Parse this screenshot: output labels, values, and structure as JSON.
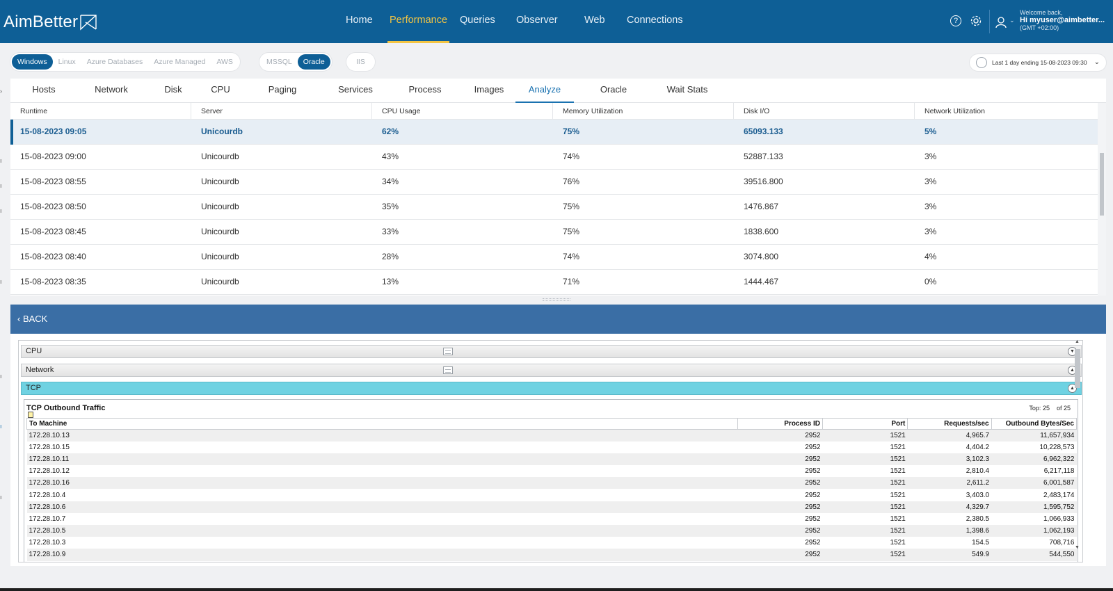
{
  "app": {
    "brand": "AimBetter",
    "nav": [
      "Home",
      "Performance",
      "Queries",
      "Observer",
      "Web",
      "Connections"
    ],
    "nav_active": "Performance",
    "user": {
      "welcome": "Welcome back,",
      "name": "Hi myuser@aimbetter...",
      "tz": "(GMT +02:00)"
    },
    "colors": {
      "header": "#0e5f96",
      "accent": "#f4c542",
      "selected_tab": "#1a72b0",
      "tcp_header": "#6fd2e2"
    }
  },
  "filters": {
    "os": [
      "Windows",
      "Linux",
      "Azure Databases",
      "Azure Managed",
      "AWS"
    ],
    "os_selected": "Windows",
    "db": [
      "MSSQL",
      "Oracle"
    ],
    "db_selected": "Oracle",
    "web": "IIS",
    "time_range": "Last 1 day ending  15-08-2023 09:30"
  },
  "tabs": [
    "Hosts",
    "Network",
    "Disk",
    "CPU",
    "Paging",
    "Services",
    "Process",
    "Images",
    "Analyze",
    "Oracle",
    "Wait Stats"
  ],
  "tab_active": "Analyze",
  "grid": {
    "columns": [
      "Runtime",
      "Server",
      "CPU Usage",
      "Memory Utilization",
      "Disk I/O",
      "Network Utilization"
    ],
    "rows": [
      [
        "15-08-2023 09:05",
        "Unicourdb",
        "62%",
        "75%",
        "65093.133",
        "5%"
      ],
      [
        "15-08-2023 09:00",
        "Unicourdb",
        "43%",
        "74%",
        "52887.133",
        "3%"
      ],
      [
        "15-08-2023 08:55",
        "Unicourdb",
        "34%",
        "76%",
        "39516.800",
        "3%"
      ],
      [
        "15-08-2023 08:50",
        "Unicourdb",
        "35%",
        "75%",
        "1476.867",
        "3%"
      ],
      [
        "15-08-2023 08:45",
        "Unicourdb",
        "33%",
        "75%",
        "1838.600",
        "3%"
      ],
      [
        "15-08-2023 08:40",
        "Unicourdb",
        "28%",
        "74%",
        "3074.800",
        "4%"
      ],
      [
        "15-08-2023 08:35",
        "Unicourdb",
        "13%",
        "71%",
        "1444.467",
        "0%"
      ]
    ],
    "selected_row": 0
  },
  "detail": {
    "back_label": "BACK",
    "sections": [
      "CPU",
      "Network",
      "TCP"
    ],
    "tcp": {
      "title": "TCP Outbound Traffic",
      "top_label": "Top:",
      "top_value": "25",
      "of_label": "of 25",
      "columns": [
        "To Machine",
        "Process ID",
        "Port",
        "Requests/sec",
        "Outbound Bytes/Sec"
      ],
      "rows": [
        [
          "172.28.10.13",
          "2952",
          "1521",
          "4,965.7",
          "11,657,934"
        ],
        [
          "172.28.10.15",
          "2952",
          "1521",
          "4,404.2",
          "10,228,573"
        ],
        [
          "172.28.10.11",
          "2952",
          "1521",
          "3,102.3",
          "6,962,322"
        ],
        [
          "172.28.10.12",
          "2952",
          "1521",
          "2,810.4",
          "6,217,118"
        ],
        [
          "172.28.10.16",
          "2952",
          "1521",
          "2,611.2",
          "6,001,587"
        ],
        [
          "172.28.10.4",
          "2952",
          "1521",
          "3,403.0",
          "2,483,174"
        ],
        [
          "172.28.10.6",
          "2952",
          "1521",
          "4,329.7",
          "1,595,752"
        ],
        [
          "172.28.10.7",
          "2952",
          "1521",
          "2,380.5",
          "1,066,933"
        ],
        [
          "172.28.10.5",
          "2952",
          "1521",
          "1,398.6",
          "1,062,193"
        ],
        [
          "172.28.10.3",
          "2952",
          "1521",
          "154.5",
          "708,716"
        ],
        [
          "172.28.10.9",
          "2952",
          "1521",
          "549.9",
          "544,550"
        ]
      ]
    }
  }
}
